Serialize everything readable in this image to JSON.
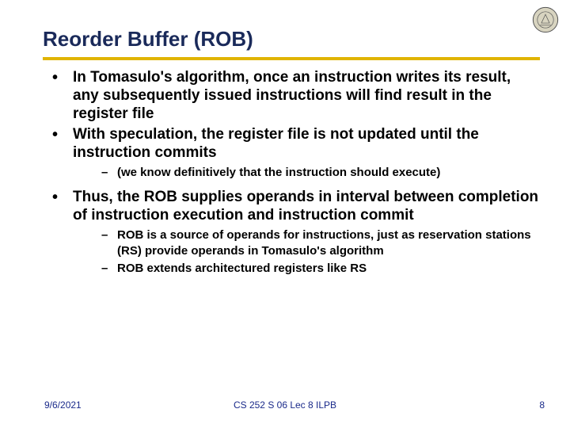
{
  "slide": {
    "title": "Reorder Buffer (ROB)",
    "bullets": [
      {
        "text": "In Tomasulo's algorithm, once an instruction writes its result, any subsequently issued instructions will find result in the register file",
        "sub": []
      },
      {
        "text": "With speculation, the register file is not updated until the instruction commits",
        "sub": [
          "(we know definitively that the instruction should execute)"
        ]
      },
      {
        "text": "Thus, the ROB supplies operands in interval between completion of instruction execution and instruction commit",
        "sub": [
          "ROB is a source of operands for instructions, just as reservation stations (RS) provide operands in Tomasulo's algorithm",
          "ROB extends architectured registers like RS"
        ]
      }
    ],
    "footer": {
      "date": "9/6/2021",
      "center": "CS 252 S 06 Lec 8 ILPB",
      "page": "8"
    },
    "seal_alt": "university-seal"
  }
}
